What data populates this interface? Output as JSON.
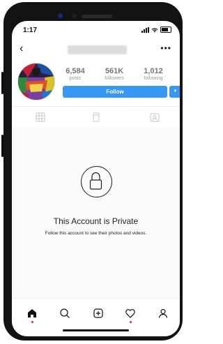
{
  "status": {
    "time": "1:17"
  },
  "profile": {
    "stats": [
      {
        "num": "6,584",
        "label": "posts"
      },
      {
        "num": "561K",
        "label": "followers"
      },
      {
        "num": "1,012",
        "label": "following"
      }
    ],
    "follow_label": "Follow"
  },
  "private": {
    "title": "This Account is Private",
    "subtitle": "Follow this account to see their photos and videos."
  },
  "colors": {
    "accent": "#3897f0",
    "notify": "#e0245e"
  }
}
